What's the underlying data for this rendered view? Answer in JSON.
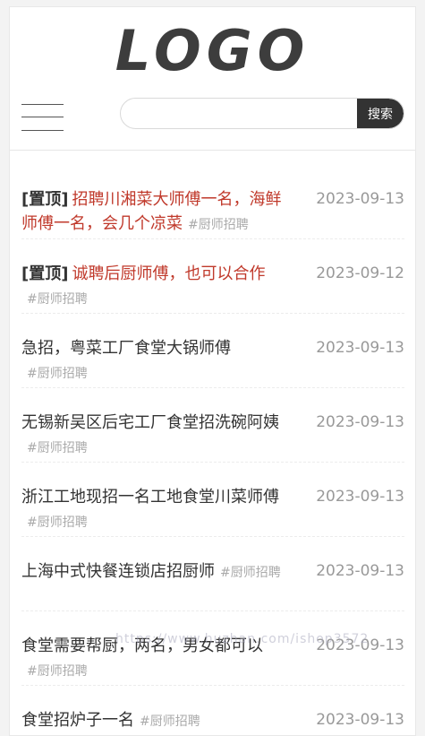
{
  "header": {
    "logo": "LOGO",
    "search_button": "搜索",
    "search_value": ""
  },
  "list": [
    {
      "pin": "[置顶]",
      "title": "招聘川湘菜大师傅一名，海鲜师傅一名，会几个凉菜",
      "tag": "#厨师招聘",
      "date": "2023-09-13"
    },
    {
      "pin": "[置顶]",
      "title": "诚聘后厨师傅，也可以合作",
      "tag": "#厨师招聘",
      "date": "2023-09-12"
    },
    {
      "pin": "",
      "title": "急招，粤菜工厂食堂大锅师傅",
      "tag": "#厨师招聘",
      "date": "2023-09-13"
    },
    {
      "pin": "",
      "title": "无锡新吴区后宅工厂食堂招洗碗阿姨",
      "tag": "#厨师招聘",
      "date": "2023-09-13"
    },
    {
      "pin": "",
      "title": "浙江工地现招一名工地食堂川菜师傅",
      "tag": "#厨师招聘",
      "date": "2023-09-13"
    },
    {
      "pin": "",
      "title": "上海中式快餐连锁店招厨师",
      "tag": "#厨师招聘",
      "date": "2023-09-13"
    },
    {
      "pin": "",
      "title": "食堂需要帮厨，两名，男女都可以",
      "tag": "#厨师招聘",
      "date": "2023-09-13"
    },
    {
      "pin": "",
      "title": "食堂招炉子一名",
      "tag": "#厨师招聘",
      "date": "2023-09-13"
    }
  ],
  "watermark": "https://www.huzhan.com/ishop3572",
  "colors": {
    "pinned_title": "#c0392b",
    "search_button_bg": "#333333",
    "tag": "#aaaaaa",
    "date": "#999999"
  }
}
